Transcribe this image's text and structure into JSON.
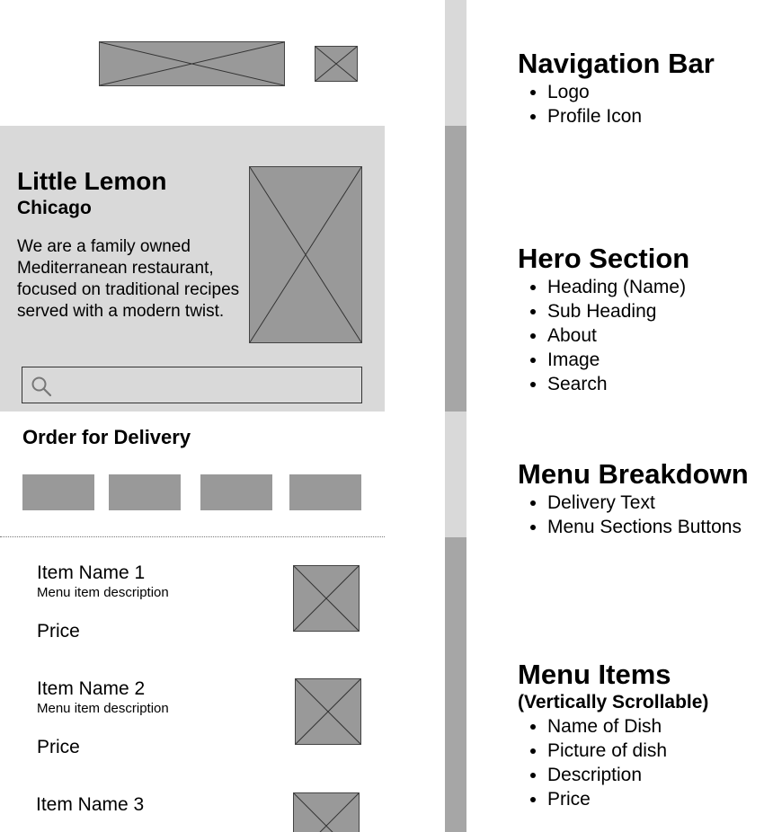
{
  "hero": {
    "title": "Little Lemon",
    "subtitle": "Chicago",
    "about": "We are a family owned Mediterranean restaurant, focused on traditional recipes served with a modern twist."
  },
  "search": {
    "placeholder": ""
  },
  "delivery": {
    "heading": "Order for Delivery"
  },
  "menu_items": [
    {
      "name": "Item Name 1",
      "description": "Menu item description",
      "price": "Price"
    },
    {
      "name": "Item Name 2",
      "description": "Menu item description",
      "price": "Price"
    },
    {
      "name": "Item Name 3"
    }
  ],
  "annotations": {
    "nav": {
      "title": "Navigation Bar",
      "items": [
        "Logo",
        "Profile Icon"
      ]
    },
    "hero": {
      "title": "Hero Section",
      "items": [
        "Heading (Name)",
        "Sub Heading",
        "About",
        "Image",
        "Search"
      ]
    },
    "menu_breakdown": {
      "title": "Menu Breakdown",
      "items": [
        "Delivery Text",
        "Menu Sections Buttons"
      ]
    },
    "menu_items": {
      "title": "Menu Items",
      "subtitle": "(Vertically Scrollable)",
      "items": [
        "Name of Dish",
        "Picture of dish",
        "Description",
        "Price"
      ]
    }
  },
  "colors": {
    "placeholder": "#999999",
    "hero_background": "#d9d9d9",
    "section_bar_light": "#d9d9d9",
    "section_bar_dark": "#a6a6a6"
  },
  "icons": [
    "search-icon"
  ]
}
